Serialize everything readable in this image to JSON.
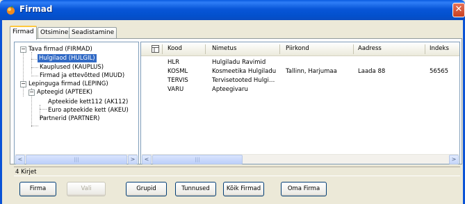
{
  "window": {
    "title": "Firmad",
    "close_glyph": "✕"
  },
  "tabs": [
    {
      "label": "Firmad",
      "active": true
    },
    {
      "label": "Otsimine",
      "active": false
    },
    {
      "label": "Seadistamine",
      "active": false
    }
  ],
  "tree": {
    "nodes": [
      {
        "label": "Tava firmad (FIRMAD)",
        "expander": "−"
      },
      {
        "label": "Hulgilaod (HULGIL)",
        "selected": true
      },
      {
        "label": "Kauplused (KAUPLUS)"
      },
      {
        "label": "Firmad ja ettevõtted (MUUD)"
      },
      {
        "label": "Lepinguga firmad (LEPING)",
        "expander": "−"
      },
      {
        "label": "Apteegid (APTEEK)",
        "expander": "−"
      },
      {
        "label": "Apteekide kett112 (AK112)"
      },
      {
        "label": "Euro apteekide kett (AKEU)"
      },
      {
        "label": "Partnerid (PARTNER)"
      }
    ]
  },
  "grid": {
    "columns": [
      "Kood",
      "Nimetus",
      "Piirkond",
      "Aadress",
      "Indeks"
    ],
    "rows": [
      [
        "HLR",
        "Hulgiladu Ravimid",
        "",
        "",
        ""
      ],
      [
        "KOSML",
        "Kosmeetika Hulgiladu",
        "Tallinn, Harjumaa",
        "Laada 88",
        "56565"
      ],
      [
        "TERVIS",
        "Tervisetooted Hulgi…",
        "",
        "",
        ""
      ],
      [
        "VARU",
        "Apteegivaru",
        "",
        "",
        ""
      ]
    ]
  },
  "scroll": {
    "left_arrow": "<",
    "right_arrow": ">",
    "thumb_grip": "|||"
  },
  "status": {
    "text": "4 Kirjet"
  },
  "buttons": {
    "firma": "Firma",
    "vali": "Vali",
    "grupid": "Grupid",
    "tunnused": "Tunnused",
    "koik_firmad": "Kõik Firmad",
    "oma_firma": "Oma Firma"
  }
}
